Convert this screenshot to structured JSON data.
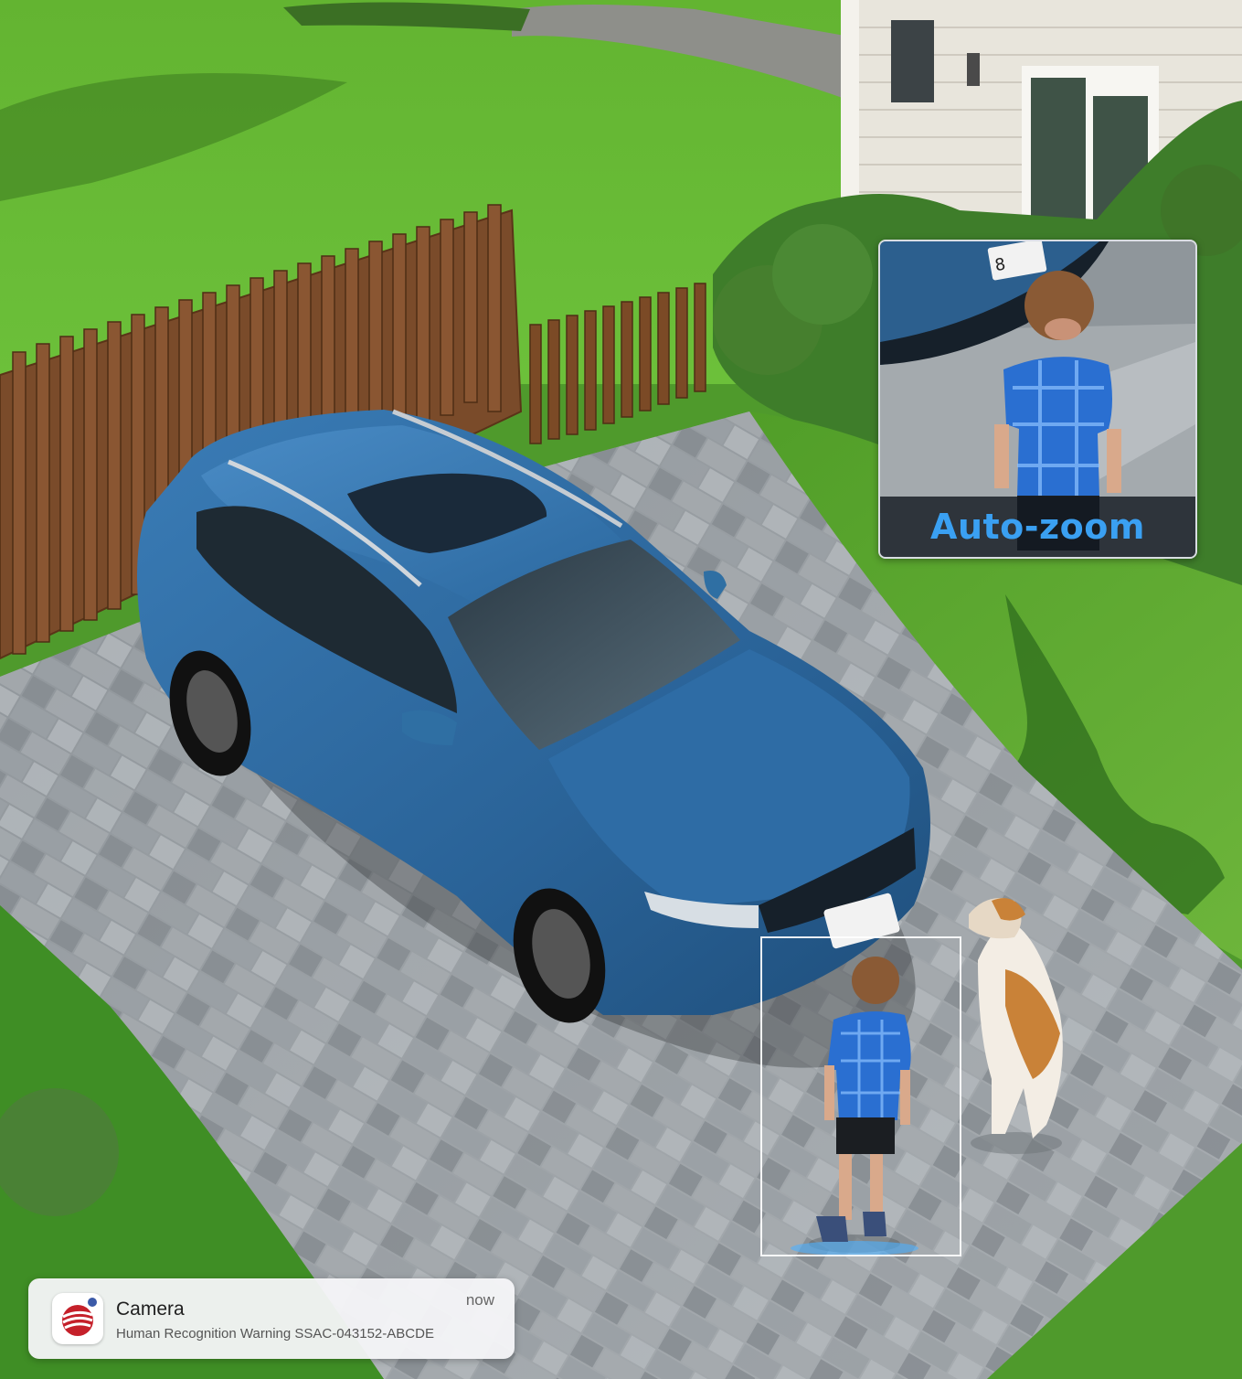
{
  "camera_view": {
    "scene": "driveway",
    "autozoom": {
      "label": "Auto-zoom"
    }
  },
  "notification": {
    "app_name": "Camera",
    "time": "now",
    "message": "Human Recognition Warning SSAC-043152-ABCDE",
    "icon": "camera-app-logo-icon"
  },
  "colors": {
    "accent": "#3aa0f2",
    "car": "#2f6fa3",
    "lawn": "#59a52e"
  }
}
